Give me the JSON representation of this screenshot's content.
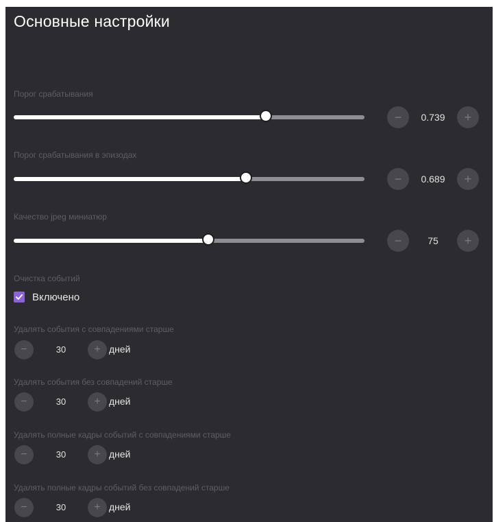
{
  "settings": {
    "title": "Основные настройки",
    "sliders": [
      {
        "label": "Порог срабатывания",
        "value": "0.739",
        "fraction": 0.719
      },
      {
        "label": "Порог срабатывания в эпизодах",
        "value": "0.689",
        "fraction": 0.662
      },
      {
        "label": "Качество jpeg миниатюр",
        "value": "75",
        "fraction": 0.555
      }
    ],
    "cleanup": {
      "label": "Очистка событий",
      "checkbox_label": "Включено",
      "checked": true
    },
    "retention": [
      {
        "label": "Удалять события с совпадениями старше",
        "value": "30",
        "unit": "дней"
      },
      {
        "label": "Удалять события без совпадений старше",
        "value": "30",
        "unit": "дней"
      },
      {
        "label": "Удалять полные кадры событий с совпадениями старше",
        "value": "30",
        "unit": "дней"
      },
      {
        "label": "Удалять полные кадры событий без совпадений старше",
        "value": "30",
        "unit": "дней"
      }
    ],
    "icons": {
      "decrement": "minus-icon",
      "increment": "plus-icon",
      "check": "check-icon"
    },
    "colors": {
      "panel": "#2b2b30",
      "accent": "#8a63d8",
      "track_fill": "#ffffff",
      "track_rest": "#8d8d92"
    }
  }
}
